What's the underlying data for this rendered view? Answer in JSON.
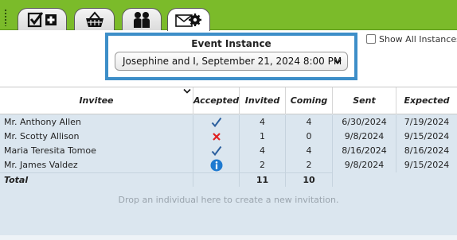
{
  "tabs": [
    {
      "icon": "checklist-add-icon"
    },
    {
      "icon": "basket-icon"
    },
    {
      "icon": "people-icon"
    },
    {
      "icon": "envelope-gear-icon",
      "active": true
    }
  ],
  "instance": {
    "label": "Event Instance",
    "selected": "Josephine and I, September 21, 2024 8:00 PM"
  },
  "show_all": {
    "label": "Show All Instances",
    "checked": false
  },
  "table": {
    "columns": [
      "Invitee",
      "Accepted",
      "Invited",
      "Coming",
      "Sent",
      "Expected"
    ],
    "rows": [
      {
        "invitee": "Mr. Anthony Allen",
        "accepted": "check",
        "invited": "4",
        "coming": "4",
        "sent": "6/30/2024",
        "expected": "7/19/2024"
      },
      {
        "invitee": "Mr. Scotty Allison",
        "accepted": "x",
        "invited": "1",
        "coming": "0",
        "sent": "9/8/2024",
        "expected": "9/15/2024"
      },
      {
        "invitee": "Maria Teresita Tomoe",
        "accepted": "check",
        "invited": "4",
        "coming": "4",
        "sent": "8/16/2024",
        "expected": "8/16/2024"
      },
      {
        "invitee": "Mr. James Valdez",
        "accepted": "info",
        "invited": "2",
        "coming": "2",
        "sent": "9/8/2024",
        "expected": "9/15/2024"
      }
    ],
    "total": {
      "label": "Total",
      "invited": "11",
      "coming": "10"
    }
  },
  "drop_hint": "Drop an individual here to create a new invitation.",
  "colors": {
    "tab_bar": "#7bbb2a",
    "highlight": "#3d8ec8",
    "grid_bg": "#dbe6ef",
    "check": "#2b5f9e",
    "x": "#e02020",
    "info": "#1f7ad0"
  }
}
